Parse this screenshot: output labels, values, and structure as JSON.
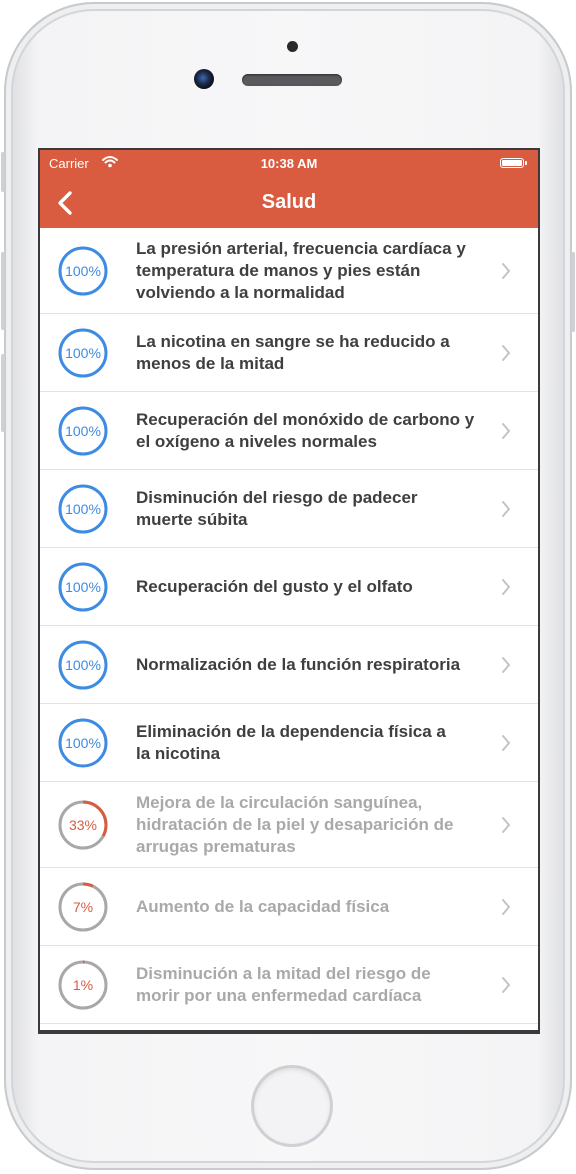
{
  "status_bar": {
    "carrier": "Carrier",
    "time": "10:38 AM"
  },
  "nav": {
    "title": "Salud"
  },
  "colors": {
    "accent": "#d95c40",
    "complete": "#3d8be3",
    "complete_text": "#3f3f41",
    "pending_track": "#a8a8aa",
    "pending_progress": "#d95c40",
    "pending_text": "#a9a9ab"
  },
  "goals": [
    {
      "percent_label": "100%",
      "progress": 1.0,
      "complete": true,
      "lines": [
        "La presión arterial, frecuencia cardíaca y",
        "temperatura de manos y pies están",
        "volviendo a la normalidad"
      ]
    },
    {
      "percent_label": "100%",
      "progress": 1.0,
      "complete": true,
      "lines": [
        "La nicotina en sangre se ha reducido a",
        "menos de la mitad"
      ]
    },
    {
      "percent_label": "100%",
      "progress": 1.0,
      "complete": true,
      "lines": [
        "Recuperación del monóxido de carbono y",
        "el oxígeno a niveles normales"
      ]
    },
    {
      "percent_label": "100%",
      "progress": 1.0,
      "complete": true,
      "lines": [
        "Disminución del riesgo de padecer",
        "muerte súbita"
      ]
    },
    {
      "percent_label": "100%",
      "progress": 1.0,
      "complete": true,
      "lines": [
        "Recuperación del gusto y el olfato"
      ]
    },
    {
      "percent_label": "100%",
      "progress": 1.0,
      "complete": true,
      "lines": [
        "Normalización de la función respiratoria"
      ]
    },
    {
      "percent_label": "100%",
      "progress": 1.0,
      "complete": true,
      "lines": [
        "Eliminación de la dependencia física a",
        "la nicotina"
      ]
    },
    {
      "percent_label": "33%",
      "progress": 0.33,
      "complete": false,
      "lines": [
        "Mejora de la circulación sanguínea,",
        "hidratación de la piel y desaparición de",
        "arrugas prematuras"
      ]
    },
    {
      "percent_label": "7%",
      "progress": 0.07,
      "complete": false,
      "lines": [
        "Aumento de la capacidad física"
      ]
    },
    {
      "percent_label": "1%",
      "progress": 0.01,
      "complete": false,
      "lines": [
        "Disminución a la mitad del riesgo de",
        "morir por una enfermedad cardíaca"
      ]
    }
  ]
}
